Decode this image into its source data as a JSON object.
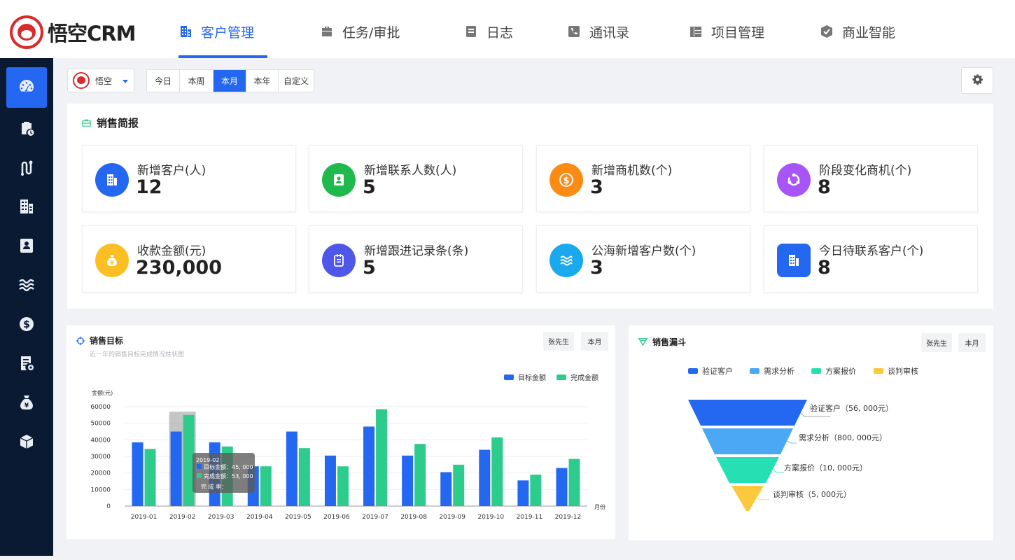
{
  "app": {
    "logo_text": "悟空CRM"
  },
  "nav": [
    {
      "label": "客户管理",
      "icon": "building-icon",
      "active": true
    },
    {
      "label": "任务/审批",
      "icon": "briefcase-icon",
      "active": false
    },
    {
      "label": "日志",
      "icon": "log-icon",
      "active": false
    },
    {
      "label": "通讯录",
      "icon": "phone-icon",
      "active": false
    },
    {
      "label": "项目管理",
      "icon": "project-icon",
      "active": false
    },
    {
      "label": "商业智能",
      "icon": "bi-icon",
      "active": false
    }
  ],
  "sidebar": [
    {
      "icon": "dashboard-icon",
      "active": true
    },
    {
      "icon": "clipboard-clock-icon",
      "active": false
    },
    {
      "icon": "route-icon",
      "active": false
    },
    {
      "icon": "building-icon",
      "active": false
    },
    {
      "icon": "contact-card-icon",
      "active": false
    },
    {
      "icon": "waves-icon",
      "active": false
    },
    {
      "icon": "dollar-icon",
      "active": false
    },
    {
      "icon": "document-icon",
      "active": false
    },
    {
      "icon": "money-bag-icon",
      "active": false
    },
    {
      "icon": "cube-icon",
      "active": false
    }
  ],
  "filter": {
    "user": "悟空",
    "ranges": [
      "今日",
      "本周",
      "本月",
      "本年",
      "自定义"
    ],
    "active_range": "本月"
  },
  "report": {
    "title": "销售简报",
    "stats": [
      {
        "label": "新增客户(人)",
        "value": "12",
        "icon": "building-icon",
        "color": "#2468f2"
      },
      {
        "label": "新增联系人数(人)",
        "value": "5",
        "icon": "contact-card-icon",
        "color": "#1fb94e"
      },
      {
        "label": "新增商机数(个)",
        "value": "3",
        "icon": "dollar-icon",
        "color": "#fa8c16"
      },
      {
        "label": "阶段变化商机(个)",
        "value": "8",
        "icon": "cycle-icon",
        "color": "#a855f7"
      },
      {
        "label": "收款金额(元)",
        "value": "230,000",
        "icon": "money-bag-icon",
        "color": "#fbbf24"
      },
      {
        "label": "新增跟进记录条(条)",
        "value": "5",
        "icon": "note-icon",
        "color": "#4f57e8"
      },
      {
        "label": "公海新增客户数(个)",
        "value": "3",
        "icon": "waves-icon",
        "color": "#1aa9ec"
      },
      {
        "label": "今日待联系客户(个)",
        "value": "8",
        "icon": "building-icon",
        "color": "#2468f2"
      }
    ]
  },
  "target": {
    "title": "销售目标",
    "subtitle": "近一年的销售目标完成情况柱状图",
    "btn_user": "张先生",
    "btn_period": "本月",
    "tooltip": {
      "title": "2019-02",
      "line1": "目标金额：45, 000",
      "line2": "完成金额：53, 000",
      "line3_label": "完 成 率："
    }
  },
  "funnel": {
    "title": "销售漏斗",
    "btn_user": "张先生",
    "btn_period": "本月",
    "legend": [
      "验证客户",
      "需求分析",
      "方案报价",
      "谈判审核"
    ],
    "labels": [
      "验证客户（56, 000元）",
      "需求分析（800, 000元）",
      "方案报价（10, 000元）",
      "谈判审核（5, 000元）"
    ],
    "colors": [
      "#2468f2",
      "#4aa8f5",
      "#26e0b4",
      "#fcc93e"
    ]
  },
  "chart_data": [
    {
      "type": "bar",
      "title": "销售目标",
      "ylabel": "金额(元)",
      "xlabel": "月份",
      "ylim": [
        0,
        60000
      ],
      "yticks": [
        0,
        10000,
        20000,
        30000,
        40000,
        50000,
        60000
      ],
      "categories": [
        "2019-01",
        "2019-02",
        "2019-03",
        "2019-04",
        "2019-05",
        "2019-06",
        "2019-07",
        "2019-08",
        "2019-09",
        "2019-10",
        "2019-11",
        "2019-12"
      ],
      "series": [
        {
          "name": "目标金额",
          "color": "#2468f2",
          "values": [
            38500,
            45000,
            38500,
            24000,
            45000,
            30500,
            48000,
            30500,
            20500,
            34000,
            15500,
            23000
          ]
        },
        {
          "name": "完成金额",
          "color": "#2ecc8c",
          "values": [
            34500,
            55000,
            36000,
            24000,
            35000,
            24000,
            58500,
            37500,
            25000,
            41500,
            19000,
            28500
          ]
        }
      ],
      "grid": true,
      "legend": "top-right"
    },
    {
      "type": "funnel",
      "title": "销售漏斗",
      "categories": [
        "验证客户",
        "需求分析",
        "方案报价",
        "谈判审核"
      ],
      "values": [
        56000,
        800000,
        10000,
        5000
      ],
      "legend": "top"
    }
  ]
}
